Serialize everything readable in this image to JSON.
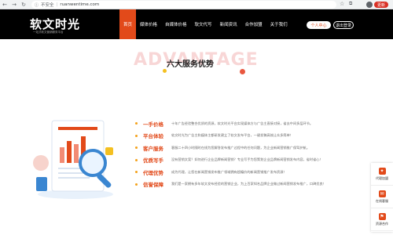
{
  "browser": {
    "insecure_label": "不安全",
    "url": "ruanwentime.com",
    "update_label": "更新"
  },
  "header": {
    "logo_text": "软文时光",
    "logo_sub": "一站式软文营销服务平台",
    "nav": [
      "首页",
      "媒体价格",
      "自媒体价格",
      "软文代写",
      "新闻资讯",
      "合作加盟",
      "关于我们"
    ],
    "user_button": "个人中心",
    "logout_button": "退出登录"
  },
  "section": {
    "background_word": "ADVANTAGE",
    "title": "六大服务优势"
  },
  "advantages": [
    {
      "title": "一手价格",
      "desc": "十年广告经验整合优质的资源，软文时光平台实现媒体方与广告主直接对接，省去中间多层环节。"
    },
    {
      "title": "平台体验",
      "desc": "软文时光为广告主和媒体主都研发建立了软文发布平台，一键发稿高效让众多简单！"
    },
    {
      "title": "客户服务",
      "desc": "客服二十四小时随时在线为您解答发布推广过程中的任何问题，为企业新闻营销推广保驾护航。"
    },
    {
      "title": "优质写手",
      "desc": "没有营销文案？如何进行企业品牌新闻营销？专业写手为您策划企业品牌新闻营销发布内容，省时省心！"
    },
    {
      "title": "代理优势",
      "desc": "成为代理，让您在新闻营销发布推广领域拥有超编价的新闻营销推广发布资源！"
    },
    {
      "title": "信誉保障",
      "desc": "我们是一家拥有多年软文发布经验的营销企业，为上百家知名品牌企业做过新闻营销发布推广，口碑优良！"
    }
  ],
  "side_float": [
    {
      "label": "代理加盟",
      "icon": "handshake-icon"
    },
    {
      "label": "在线客服",
      "icon": "chat-icon"
    },
    {
      "label": "资源合作",
      "icon": "cooperation-icon"
    }
  ],
  "colors": {
    "accent": "#e24a1a",
    "header_bg": "#000000",
    "bullet": "#f4a11a"
  }
}
